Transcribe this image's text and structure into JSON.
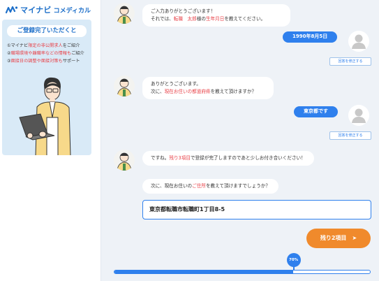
{
  "logo": {
    "main": "マイナビ",
    "sub": "コメディカル"
  },
  "promo": {
    "title": "ご登録完了いただくと",
    "items": [
      {
        "pre": "①マイナビ",
        "hl": "限定の非公開求人",
        "post": "をご紹介"
      },
      {
        "pre": "②",
        "hl": "職場環境や離職率などの情報も",
        "post": "ご紹介"
      },
      {
        "pre": "③",
        "hl": "面接日の調整や面接対策も",
        "post": "サポート"
      }
    ]
  },
  "messages": {
    "bot1": {
      "line1": "ご入力ありがとうございます！",
      "line2_pre": "それでは、",
      "line2_name": "転職　太郎",
      "line2_mid": "様の",
      "line2_hl": "生年月日",
      "line2_post": "を教えてください。"
    },
    "user1": "1990年8月5日",
    "edit_label": "回答を修正する",
    "bot2": {
      "line1": "ありがとうございます。",
      "line2_pre": "次に、",
      "line2_hl": "現在お住いの都道府県",
      "line2_post": "を教えて頂けますか？"
    },
    "user2": "東京都です",
    "bot3": {
      "pre": "ですね。",
      "hl": "残り3項目",
      "post": "で登録が完了しますのであと少しお付き合いください！"
    },
    "bot4": {
      "pre": "次に、現在お住いの",
      "hl": "ご住所",
      "post": "を教えて頂けますでしょうか？"
    }
  },
  "input": {
    "value": "東京都転職市転職町1丁目8-5"
  },
  "next_button": {
    "label": "残り2項目",
    "arrow": "➤"
  },
  "progress": {
    "percent": 70,
    "label": "70%"
  },
  "colors": {
    "primary": "#2f80ed",
    "accent": "#f08a2c",
    "highlight": "#e8434a"
  }
}
